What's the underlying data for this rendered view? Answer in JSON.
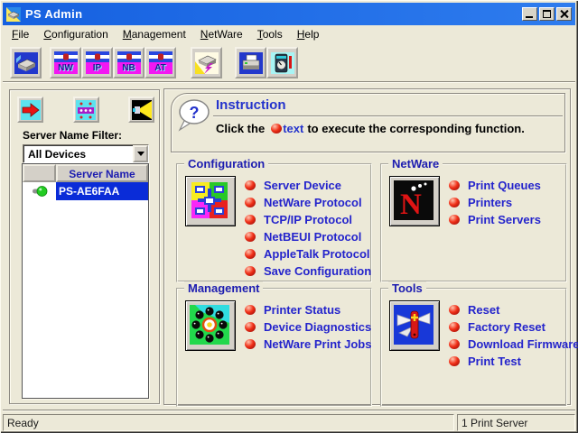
{
  "window": {
    "title": "PS Admin"
  },
  "menu": {
    "items": [
      "File",
      "Configuration",
      "Management",
      "NetWare",
      "Tools",
      "Help"
    ]
  },
  "toolbar": {
    "flags": [
      "NW",
      "IP",
      "NB",
      "AT"
    ]
  },
  "sidebar": {
    "filter_label": "Server Name Filter:",
    "filter_value": "All Devices",
    "list_header": "Server Name",
    "server_name": "PS-AE6FAA"
  },
  "instruction": {
    "title": "Instruction",
    "text_prefix": "Click the",
    "link_word": "text",
    "text_suffix": "to execute the corresponding function."
  },
  "groups": [
    {
      "title": "Configuration",
      "items": [
        "Server Device",
        "NetWare Protocol",
        "TCP/IP Protocol",
        "NetBEUI Protocol",
        "AppleTalk Protocol",
        "Save Configuration"
      ]
    },
    {
      "title": "NetWare",
      "items": [
        "Print Queues",
        "Printers",
        "Print Servers"
      ]
    },
    {
      "title": "Management",
      "items": [
        "Printer Status",
        "Device Diagnostics",
        "NetWare Print Jobs"
      ]
    },
    {
      "title": "Tools",
      "items": [
        "Reset",
        "Factory Reset",
        "Download Firmware",
        "Print Test"
      ]
    }
  ],
  "statusbar": {
    "left": "Ready",
    "right": "1 Print Server"
  },
  "icons": {
    "question_mark": "?",
    "netware_n": "N"
  },
  "colors": {
    "titlebar_blue": "#1b6ae8",
    "accent_blue": "#2424cc",
    "bullet_red": "#e01010",
    "selection_blue": "#0a2cd8",
    "led_green": "#22cc22",
    "background_cream": "#ece9d8"
  }
}
